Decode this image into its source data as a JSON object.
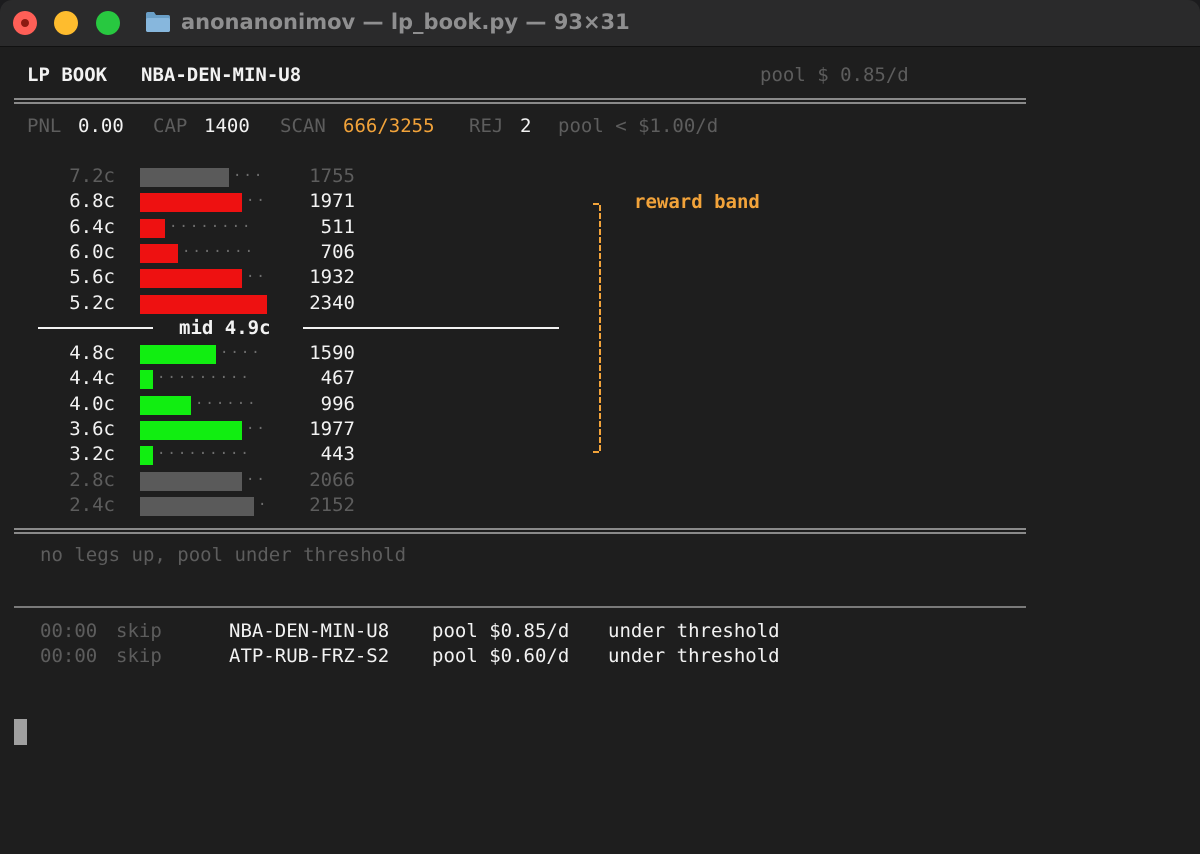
{
  "window": {
    "title": "anonanonimov — lp_book.py — 93×31",
    "controls": [
      "close",
      "minimize",
      "zoom"
    ]
  },
  "header": {
    "app": "LP BOOK",
    "market": "NBA-DEN-MIN-U8",
    "pool": "pool $ 0.85/d"
  },
  "stats": {
    "pnl_label": "PNL",
    "pnl_value": "0.00",
    "cap_label": "CAP",
    "cap_value": "1400",
    "scan_label": "SCAN",
    "scan_value": "666/3255",
    "rej_label": "REJ",
    "rej_value": "2",
    "pool_threshold": "pool < $1.00/d"
  },
  "book": {
    "asks": [
      {
        "price": "7.2c",
        "size": "1755",
        "fill": 0.7,
        "in_band": false
      },
      {
        "price": "6.8c",
        "size": "1971",
        "fill": 0.8,
        "in_band": true
      },
      {
        "price": "6.4c",
        "size": "511",
        "fill": 0.2,
        "in_band": true
      },
      {
        "price": "6.0c",
        "size": "706",
        "fill": 0.3,
        "in_band": true
      },
      {
        "price": "5.6c",
        "size": "1932",
        "fill": 0.8,
        "in_band": true
      },
      {
        "price": "5.2c",
        "size": "2340",
        "fill": 1.0,
        "in_band": true
      }
    ],
    "mid": "mid 4.9c",
    "bids": [
      {
        "price": "4.8c",
        "size": "1590",
        "fill": 0.6,
        "in_band": true
      },
      {
        "price": "4.4c",
        "size": "467",
        "fill": 0.1,
        "in_band": true
      },
      {
        "price": "4.0c",
        "size": "996",
        "fill": 0.4,
        "in_band": true
      },
      {
        "price": "3.6c",
        "size": "1977",
        "fill": 0.8,
        "in_band": true
      },
      {
        "price": "3.2c",
        "size": "443",
        "fill": 0.1,
        "in_band": true
      },
      {
        "price": "2.8c",
        "size": "2066",
        "fill": 0.8,
        "in_band": false
      },
      {
        "price": "2.4c",
        "size": "2152",
        "fill": 0.9,
        "in_band": false
      }
    ],
    "band_label": "reward band",
    "colors": {
      "ask": "#ee1111",
      "bid": "#11ee11",
      "outside": "#5a5a5a",
      "band": "#f2a33a"
    }
  },
  "status": {
    "message": "no legs up, pool under threshold"
  },
  "log": [
    {
      "time": "00:00",
      "action": "skip",
      "market": "NBA-DEN-MIN-U8",
      "pool": "pool $0.85/d",
      "reason": "under threshold"
    },
    {
      "time": "00:00",
      "action": "skip",
      "market": "ATP-RUB-FRZ-S2",
      "pool": "pool $0.60/d",
      "reason": "under threshold"
    }
  ]
}
